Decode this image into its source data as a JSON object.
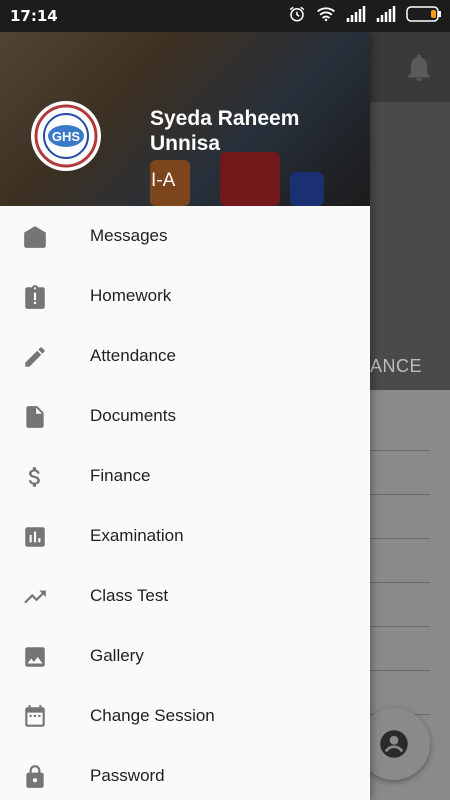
{
  "status_bar": {
    "time": "17:14"
  },
  "background_app": {
    "tab_partial": "ANCE"
  },
  "drawer": {
    "header": {
      "name": "Syeda Raheem Unnisa",
      "class": "I-A",
      "logo_text": "GHS"
    },
    "items": [
      {
        "label": "Messages",
        "icon": "mail-icon"
      },
      {
        "label": "Homework",
        "icon": "clipboard-alert-icon"
      },
      {
        "label": "Attendance",
        "icon": "pencil-icon"
      },
      {
        "label": "Documents",
        "icon": "document-icon"
      },
      {
        "label": "Finance",
        "icon": "dollar-icon"
      },
      {
        "label": "Examination",
        "icon": "bar-chart-icon"
      },
      {
        "label": "Class Test",
        "icon": "trending-up-icon"
      },
      {
        "label": "Gallery",
        "icon": "image-icon"
      },
      {
        "label": "Change Session",
        "icon": "calendar-icon"
      },
      {
        "label": "Password",
        "icon": "lock-icon"
      }
    ]
  },
  "colors": {
    "icon_gray": "#757575",
    "text": "#212121",
    "scrim": "#8f8f8f"
  }
}
